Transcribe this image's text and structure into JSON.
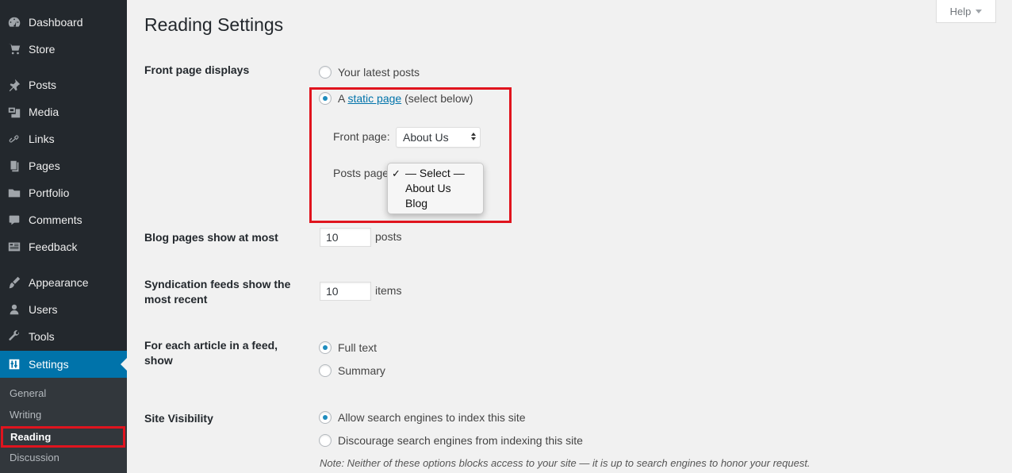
{
  "sidebar": {
    "items": [
      {
        "label": "Dashboard",
        "icon": "dashboard-icon"
      },
      {
        "label": "Store",
        "icon": "cart-icon"
      },
      {
        "label": "Posts",
        "icon": "pin-icon"
      },
      {
        "label": "Media",
        "icon": "media-icon"
      },
      {
        "label": "Links",
        "icon": "link-icon"
      },
      {
        "label": "Pages",
        "icon": "page-icon"
      },
      {
        "label": "Portfolio",
        "icon": "folder-icon"
      },
      {
        "label": "Comments",
        "icon": "comment-icon"
      },
      {
        "label": "Feedback",
        "icon": "feedback-icon"
      },
      {
        "label": "Appearance",
        "icon": "brush-icon"
      },
      {
        "label": "Users",
        "icon": "user-icon"
      },
      {
        "label": "Tools",
        "icon": "wrench-icon"
      },
      {
        "label": "Settings",
        "icon": "settings-icon"
      }
    ],
    "submenu": [
      "General",
      "Writing",
      "Reading",
      "Discussion"
    ],
    "current_item": "Settings",
    "current_submenu": "Reading"
  },
  "header": {
    "help_label": "Help"
  },
  "page": {
    "title": "Reading Settings"
  },
  "front_page": {
    "label": "Front page displays",
    "option_latest": "Your latest posts",
    "option_static_prefix": "A",
    "option_static_link": "static page",
    "option_static_suffix": "(select below)",
    "selected": "static",
    "front_page_label": "Front page:",
    "front_page_value": "About Us",
    "posts_page_label": "Posts page",
    "posts_page_options": [
      "— Select —",
      "About Us",
      "Blog"
    ],
    "posts_page_checked": "— Select —",
    "check_mark": "✓"
  },
  "blog_pages": {
    "label": "Blog pages show at most",
    "value": "10",
    "suffix": "posts"
  },
  "syndication": {
    "label": "Syndication feeds show the most recent",
    "value": "10",
    "suffix": "items"
  },
  "feed_article": {
    "label": "For each article in a feed, show",
    "option_full": "Full text",
    "option_summary": "Summary",
    "selected": "full"
  },
  "visibility": {
    "label": "Site Visibility",
    "option_allow": "Allow search engines to index this site",
    "option_discourage": "Discourage search engines from indexing this site",
    "selected": "allow",
    "note": "Note: Neither of these options blocks access to your site — it is up to search engines to honor your request."
  },
  "colors": {
    "sidebar_bg": "#23282d",
    "submenu_bg": "#32373c",
    "accent": "#0073aa",
    "highlight": "#e0141e",
    "page_bg": "#f1f1f1"
  }
}
